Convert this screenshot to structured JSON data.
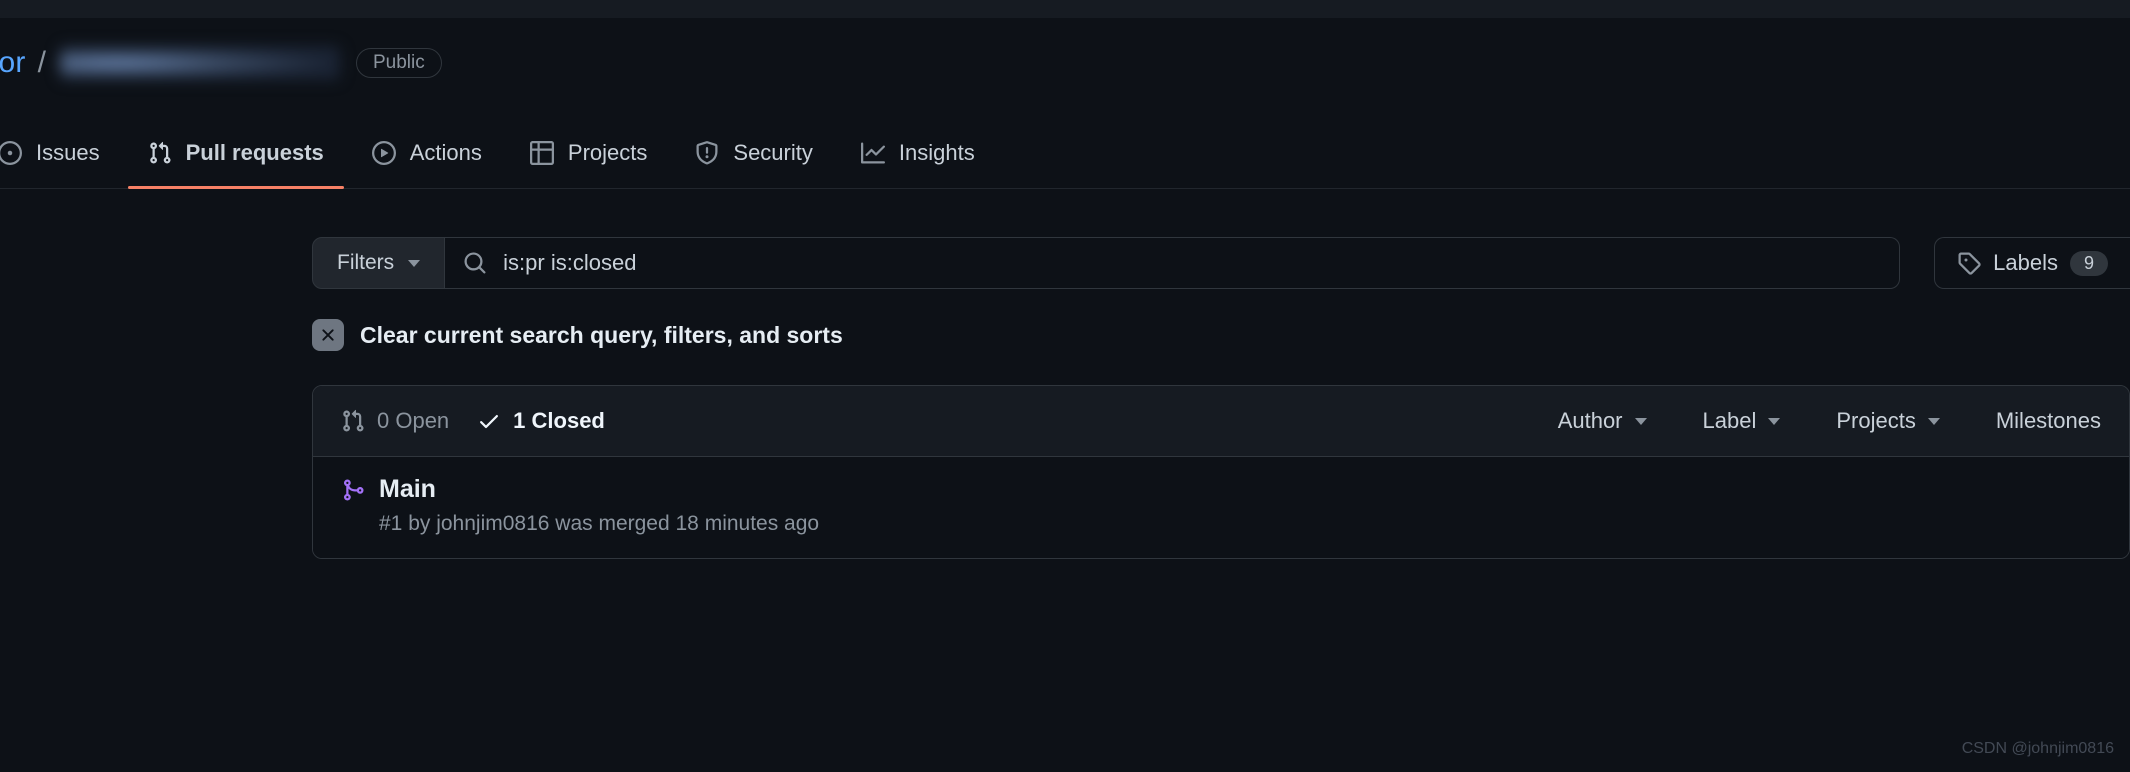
{
  "repo": {
    "owner_fragment": "tor",
    "separator": "/",
    "visibility": "Public"
  },
  "tabs": {
    "issues": "Issues",
    "pulls": "Pull requests",
    "actions": "Actions",
    "projects": "Projects",
    "security": "Security",
    "insights": "Insights"
  },
  "filters": {
    "button_label": "Filters",
    "search_value": "is:pr is:closed"
  },
  "labels": {
    "label": "Labels",
    "count": "9"
  },
  "clear": {
    "text": "Clear current search query, filters, and sorts"
  },
  "pr_header": {
    "open_text": "0 Open",
    "closed_text": "1 Closed",
    "filter_author": "Author",
    "filter_label": "Label",
    "filter_projects": "Projects",
    "filter_milestones": "Milestones"
  },
  "pr_item": {
    "title": "Main",
    "subtitle": "#1 by johnjim0816 was merged 18 minutes ago"
  },
  "watermark": "CSDN @johnjim0816"
}
